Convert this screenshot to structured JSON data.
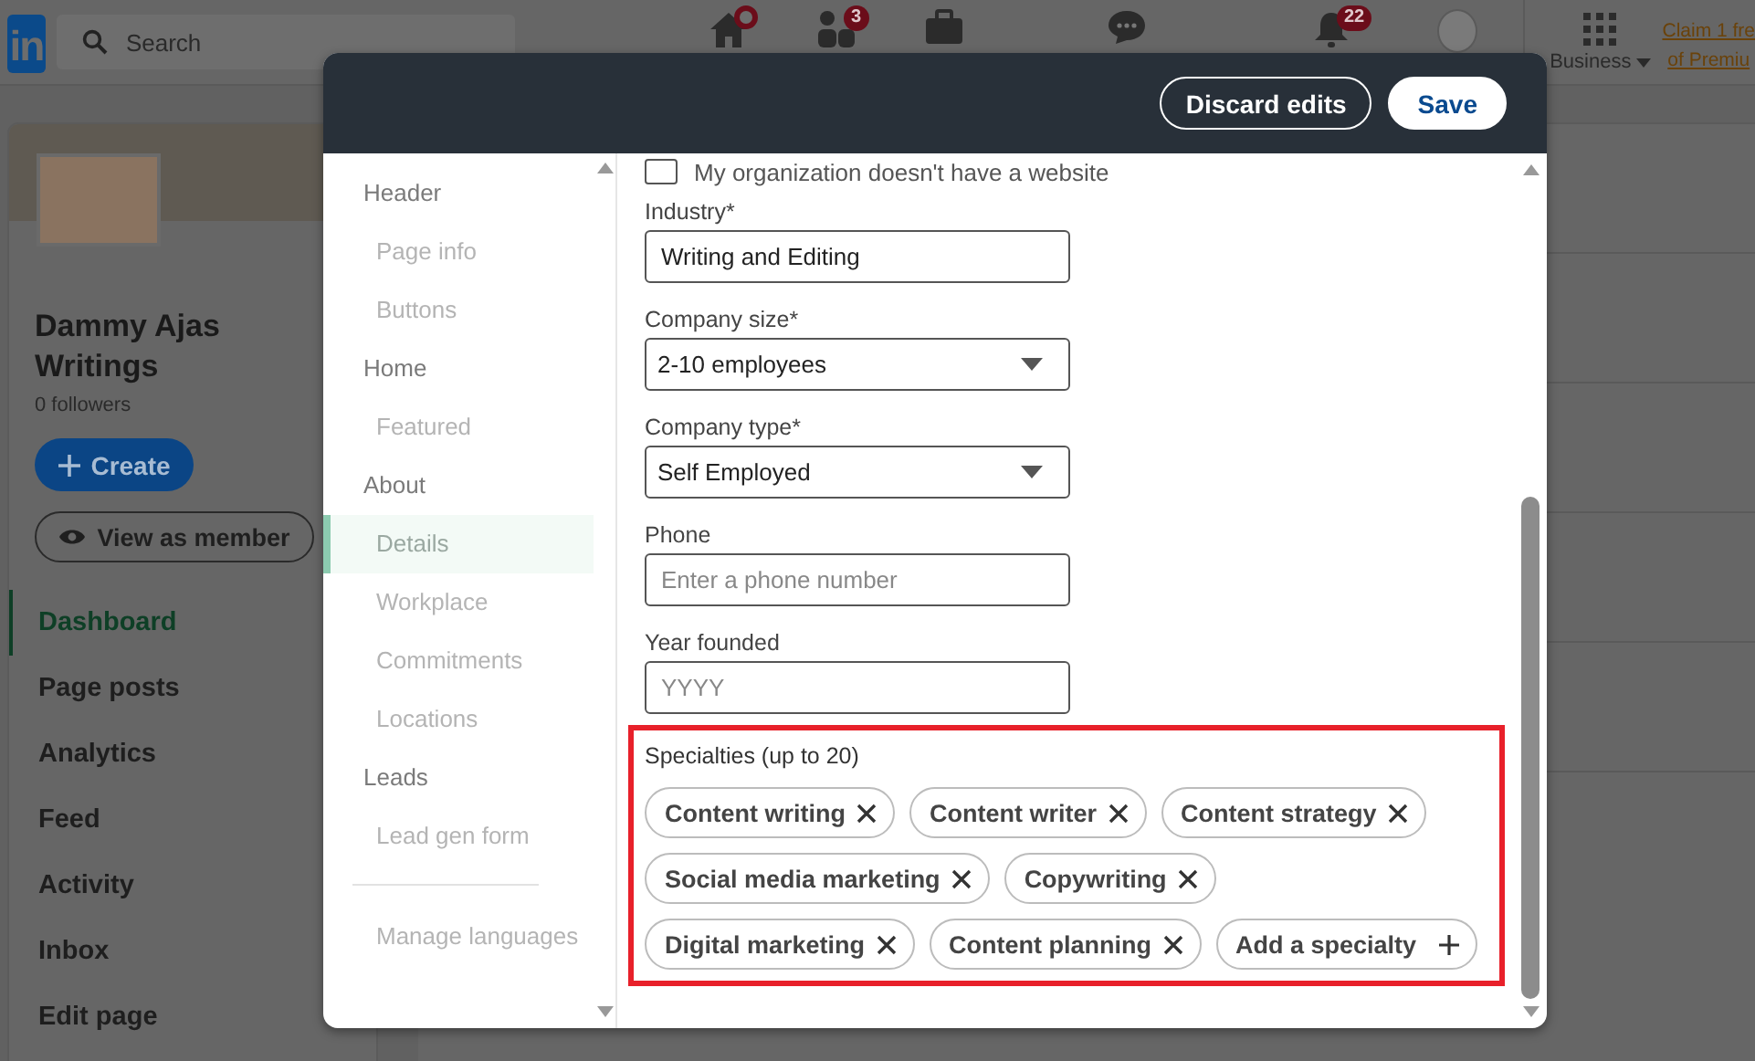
{
  "top_nav": {
    "logo": "in",
    "search": {
      "placeholder": "Search"
    },
    "icons": [
      {
        "kind": "home",
        "dot": true
      },
      {
        "kind": "people",
        "badge": "3"
      },
      {
        "kind": "briefcase"
      },
      {
        "kind": "chat"
      },
      {
        "kind": "bell",
        "badge": "22"
      },
      {
        "kind": "avatar"
      }
    ],
    "business": "Business",
    "premium_lines": [
      "Claim 1 fre",
      "of Premiu"
    ]
  },
  "sidebar": {
    "name": "Dammy Ajas Writings",
    "followers": "0 followers",
    "create": "Create",
    "view_as_member": "View as member",
    "items": [
      {
        "label": "Dashboard",
        "selected": true
      },
      {
        "label": "Page posts",
        "selected": false
      },
      {
        "label": "Analytics",
        "selected": false
      },
      {
        "label": "Feed",
        "selected": false
      },
      {
        "label": "Activity",
        "selected": false
      },
      {
        "label": "Inbox",
        "selected": false
      },
      {
        "label": "Edit page",
        "selected": false
      }
    ]
  },
  "modal": {
    "buttons": [
      {
        "label": "Discard edits",
        "kind": "secondary"
      },
      {
        "label": "Save",
        "kind": "primary"
      }
    ],
    "nav": [
      {
        "label": "Header",
        "kind": "heading",
        "selected": false
      },
      {
        "label": "Page info",
        "kind": "sub",
        "selected": false
      },
      {
        "label": "Buttons",
        "kind": "sub",
        "selected": false
      },
      {
        "label": "Home",
        "kind": "heading",
        "selected": false
      },
      {
        "label": "Featured",
        "kind": "sub",
        "selected": false
      },
      {
        "label": "About",
        "kind": "heading",
        "selected": false
      },
      {
        "label": "Details",
        "kind": "sub",
        "selected": true
      },
      {
        "label": "Workplace",
        "kind": "sub",
        "selected": false
      },
      {
        "label": "Commitments",
        "kind": "sub",
        "selected": false
      },
      {
        "label": "Locations",
        "kind": "sub",
        "selected": false
      },
      {
        "label": "Leads",
        "kind": "heading",
        "selected": false
      },
      {
        "label": "Lead gen form",
        "kind": "sub",
        "selected": false
      }
    ],
    "nav_footer": "Manage languages",
    "website_checkbox": {
      "label": "My organization doesn't have a website",
      "checked": false
    },
    "fields": [
      {
        "label": "Industry*",
        "kind": "text",
        "value": "Writing and Editing"
      },
      {
        "label": "Company size*",
        "kind": "select",
        "value": "2-10 employees"
      },
      {
        "label": "Company type*",
        "kind": "select",
        "value": "Self Employed"
      },
      {
        "label": "Phone",
        "kind": "text",
        "placeholder": "Enter a phone number"
      },
      {
        "label": "Year founded",
        "kind": "text",
        "placeholder": "YYYY"
      }
    ],
    "specialties": {
      "label": "Specialties (up to 20)",
      "rows": [
        [
          "Content writing",
          "Content writer",
          "Content strategy"
        ],
        [
          "Social media marketing",
          "Copywriting"
        ],
        [
          "Digital marketing",
          "Content planning"
        ]
      ],
      "add_label": "Add a specialty"
    }
  }
}
